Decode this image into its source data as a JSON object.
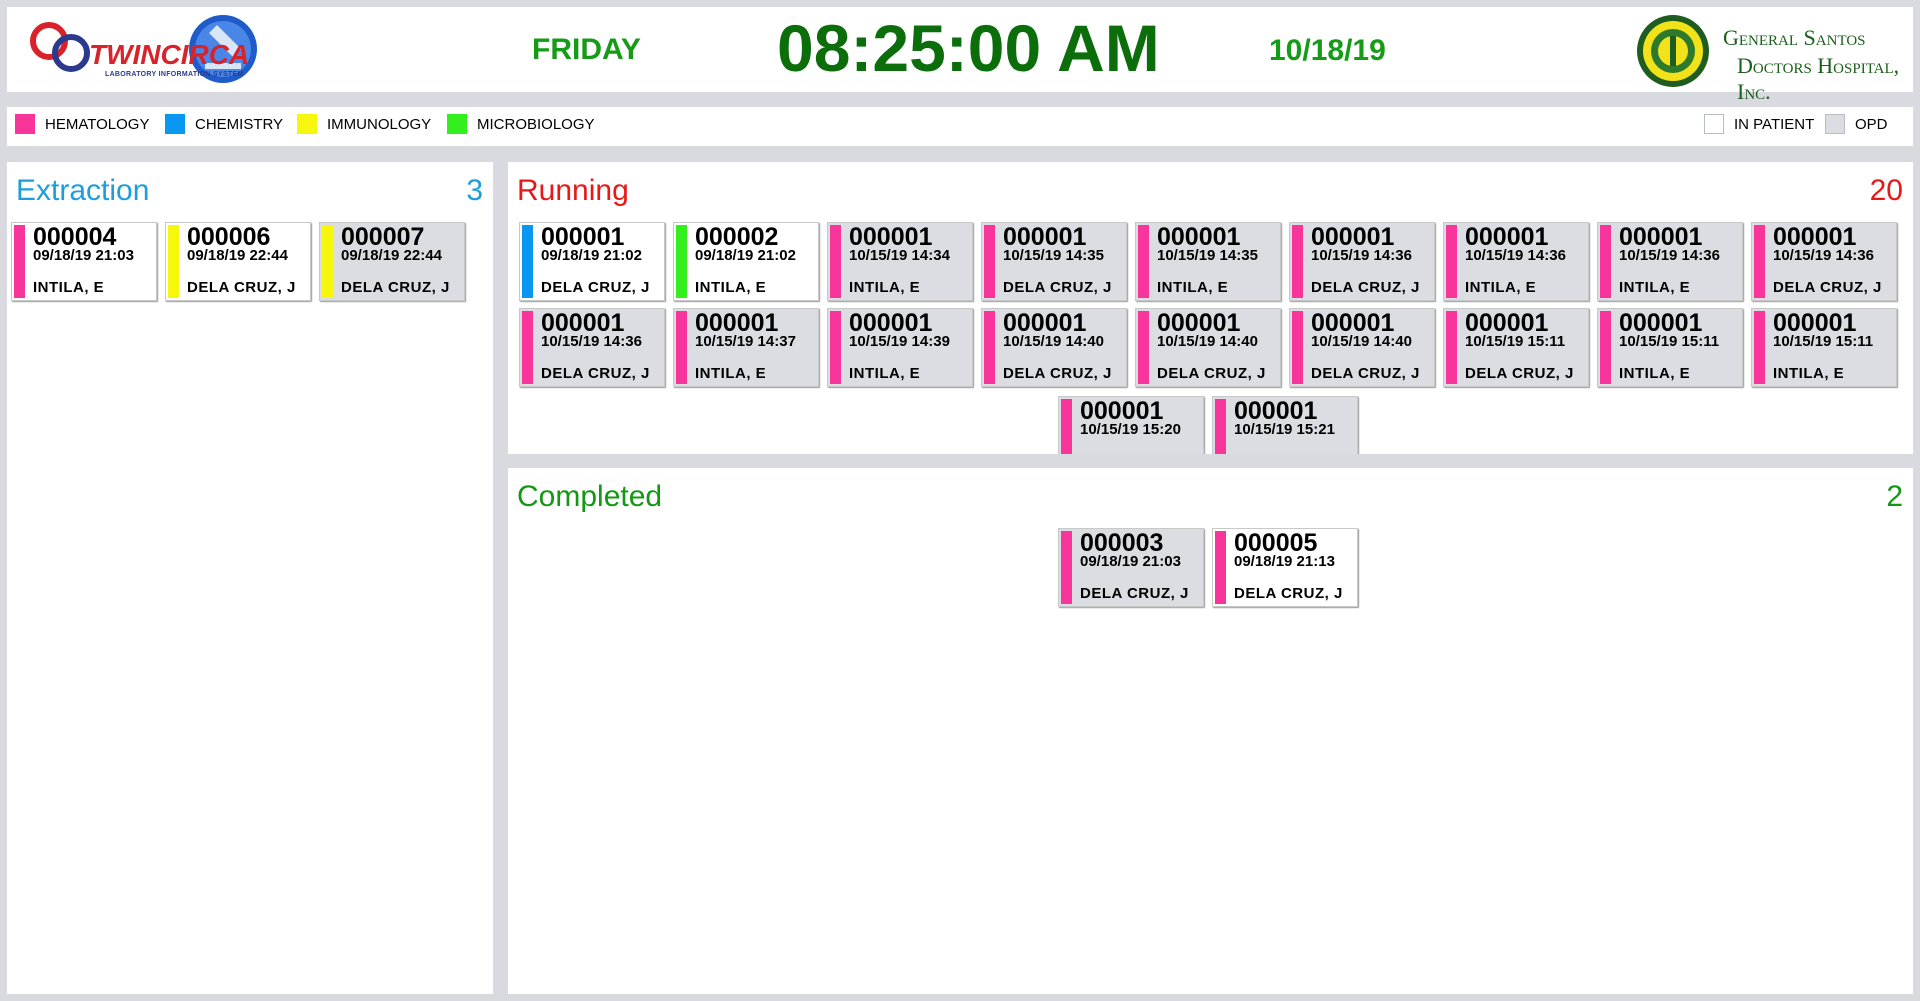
{
  "header": {
    "logo_left_text": "TWINCIRCA",
    "logo_left_tagline": "LABORATORY INFORMATION SYSTEM",
    "day": "FRIDAY",
    "time": "08:25:00 AM",
    "date": "10/18/19",
    "hospital_line1": "General Santos",
    "hospital_line2": "Doctors Hospital, Inc."
  },
  "colors": {
    "hematology": "#f7359b",
    "chemistry": "#0a97f0",
    "immunology": "#f7f70e",
    "microbiology": "#33ef1e",
    "extraction": "#1e9ed8",
    "running": "#e81818",
    "completed": "#129812"
  },
  "legend": {
    "departments": [
      {
        "label": "HEMATOLOGY",
        "color": "#f7359b"
      },
      {
        "label": "CHEMISTRY",
        "color": "#0a97f0"
      },
      {
        "label": "IMMUNOLOGY",
        "color": "#f7f70e"
      },
      {
        "label": "MICROBIOLOGY",
        "color": "#33ef1e"
      }
    ],
    "in_patient": "IN PATIENT",
    "opd": "OPD"
  },
  "extraction": {
    "title": "Extraction",
    "count": "3",
    "cards": [
      {
        "num": "000004",
        "datetime": "09/18/19 21:03",
        "name": "INTILA, E",
        "dept": "hematology",
        "type": "inpatient"
      },
      {
        "num": "000006",
        "datetime": "09/18/19 22:44",
        "name": "DELA CRUZ, J",
        "dept": "immunology",
        "type": "inpatient"
      },
      {
        "num": "000007",
        "datetime": "09/18/19 22:44",
        "name": "DELA CRUZ, J",
        "dept": "immunology",
        "type": "opd"
      }
    ]
  },
  "running": {
    "title": "Running",
    "count": "20",
    "cards": [
      {
        "num": "000001",
        "datetime": "09/18/19 21:02",
        "name": "DELA CRUZ, J",
        "dept": "chemistry",
        "type": "inpatient"
      },
      {
        "num": "000002",
        "datetime": "09/18/19 21:02",
        "name": "INTILA, E",
        "dept": "microbiology",
        "type": "inpatient"
      },
      {
        "num": "000001",
        "datetime": "10/15/19 14:34",
        "name": "INTILA, E",
        "dept": "hematology",
        "type": "opd"
      },
      {
        "num": "000001",
        "datetime": "10/15/19 14:35",
        "name": "DELA CRUZ, J",
        "dept": "hematology",
        "type": "opd"
      },
      {
        "num": "000001",
        "datetime": "10/15/19 14:35",
        "name": "INTILA, E",
        "dept": "hematology",
        "type": "opd"
      },
      {
        "num": "000001",
        "datetime": "10/15/19 14:36",
        "name": "DELA CRUZ, J",
        "dept": "hematology",
        "type": "opd"
      },
      {
        "num": "000001",
        "datetime": "10/15/19 14:36",
        "name": "INTILA, E",
        "dept": "hematology",
        "type": "opd"
      },
      {
        "num": "000001",
        "datetime": "10/15/19 14:36",
        "name": "INTILA, E",
        "dept": "hematology",
        "type": "opd"
      },
      {
        "num": "000001",
        "datetime": "10/15/19 14:36",
        "name": "DELA CRUZ, J",
        "dept": "hematology",
        "type": "opd"
      },
      {
        "num": "000001",
        "datetime": "10/15/19 14:36",
        "name": "DELA CRUZ, J",
        "dept": "hematology",
        "type": "opd"
      },
      {
        "num": "000001",
        "datetime": "10/15/19 14:37",
        "name": "INTILA, E",
        "dept": "hematology",
        "type": "opd"
      },
      {
        "num": "000001",
        "datetime": "10/15/19 14:39",
        "name": "INTILA, E",
        "dept": "hematology",
        "type": "opd"
      },
      {
        "num": "000001",
        "datetime": "10/15/19 14:40",
        "name": "DELA CRUZ, J",
        "dept": "hematology",
        "type": "opd"
      },
      {
        "num": "000001",
        "datetime": "10/15/19 14:40",
        "name": "DELA CRUZ, J",
        "dept": "hematology",
        "type": "opd"
      },
      {
        "num": "000001",
        "datetime": "10/15/19 14:40",
        "name": "DELA CRUZ, J",
        "dept": "hematology",
        "type": "opd"
      },
      {
        "num": "000001",
        "datetime": "10/15/19 15:11",
        "name": "DELA CRUZ, J",
        "dept": "hematology",
        "type": "opd"
      },
      {
        "num": "000001",
        "datetime": "10/15/19 15:11",
        "name": "INTILA, E",
        "dept": "hematology",
        "type": "opd"
      },
      {
        "num": "000001",
        "datetime": "10/15/19 15:11",
        "name": "INTILA, E",
        "dept": "hematology",
        "type": "opd"
      },
      {
        "num": "000001",
        "datetime": "10/15/19 15:20",
        "name": "",
        "dept": "hematology",
        "type": "opd"
      },
      {
        "num": "000001",
        "datetime": "10/15/19 15:21",
        "name": "",
        "dept": "hematology",
        "type": "opd"
      }
    ]
  },
  "completed": {
    "title": "Completed",
    "count": "2",
    "cards": [
      {
        "num": "000003",
        "datetime": "09/18/19 21:03",
        "name": "DELA CRUZ, J",
        "dept": "hematology",
        "type": "opd"
      },
      {
        "num": "000005",
        "datetime": "09/18/19 21:13",
        "name": "DELA CRUZ, J",
        "dept": "hematology",
        "type": "inpatient"
      }
    ]
  }
}
